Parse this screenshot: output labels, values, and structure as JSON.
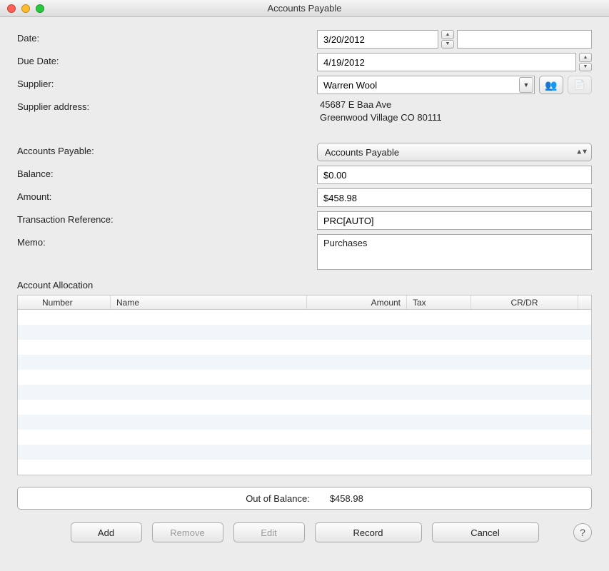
{
  "window": {
    "title": "Accounts Payable"
  },
  "labels": {
    "date": "Date:",
    "due_date": "Due Date:",
    "supplier": "Supplier:",
    "supplier_address": "Supplier address:",
    "accounts_payable": "Accounts Payable:",
    "balance": "Balance:",
    "amount": "Amount:",
    "txn_ref": "Transaction Reference:",
    "memo": "Memo:",
    "allocation_title": "Account Allocation",
    "out_of_balance": "Out of Balance:"
  },
  "fields": {
    "date": "3/20/2012",
    "due_date": "4/19/2012",
    "supplier": "Warren Wool",
    "supplier_address": "45687 E Baa Ave\nGreenwood Village CO 80111",
    "accounts_payable_select": "Accounts Payable",
    "balance": "$0.00",
    "amount": "$458.98",
    "txn_ref": "PRC[AUTO]",
    "memo": "Purchases",
    "out_of_balance_amount": "$458.98"
  },
  "table": {
    "headers": {
      "number": "Number",
      "name": "Name",
      "amount": "Amount",
      "tax": "Tax",
      "crdr": "CR/DR"
    }
  },
  "buttons": {
    "add": "Add",
    "remove": "Remove",
    "edit": "Edit",
    "record": "Record",
    "cancel": "Cancel",
    "help": "?"
  }
}
